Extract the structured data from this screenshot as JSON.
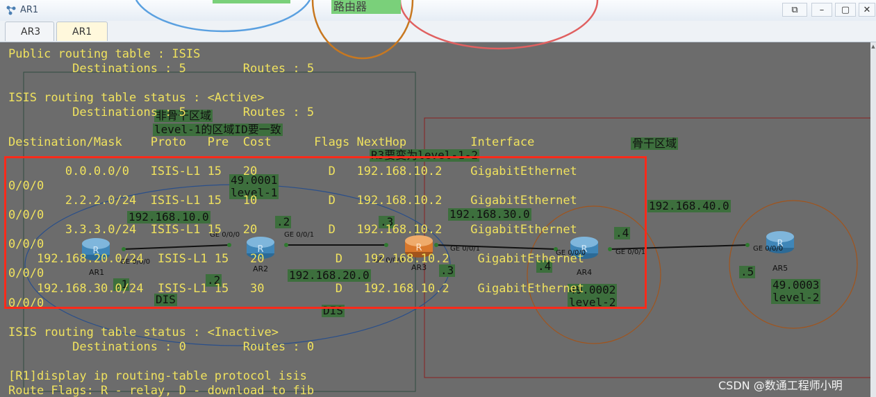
{
  "window": {
    "title": "AR1",
    "controls": [
      "⧉",
      "–",
      "▢",
      "✕"
    ]
  },
  "tabs": [
    {
      "label": "AR3",
      "active": false
    },
    {
      "label": "AR1",
      "active": true
    }
  ],
  "console_text": "Public routing table : ISIS\n         Destinations : 5        Routes : 5\n\nISIS routing table status : <Active>\n         Destinations : 5        Routes : 5\n\nDestination/Mask    Proto   Pre  Cost      Flags NextHop         Interface\n\n        0.0.0.0/0   ISIS-L1 15   20          D   192.168.10.2    GigabitEthernet\n0/0/0\n        2.2.2.0/24  ISIS-L1 15   10          D   192.168.10.2    GigabitEthernet\n0/0/0\n        3.3.3.0/24  ISIS-L1 15   20          D   192.168.10.2    GigabitEthernet\n0/0/0\n    192.168.20.0/24  ISIS-L1 15   20          D   192.168.10.2    GigabitEthernet\n0/0/0\n    192.168.30.0/24  ISIS-L1 15   30          D   192.168.10.2    GigabitEthernet\n0/0/0\n\nISIS routing table status : <Inactive>\n         Destinations : 0        Routes : 0\n\n[R1]display ip routing-table protocol isis\nRoute Flags: R - relay, D - download to fib",
  "topology": {
    "routers": [
      "AR1",
      "AR2",
      "AR3",
      "AR4",
      "AR5"
    ],
    "interfaces": {
      "ar1_ge": "GE 0/0/0",
      "ar2_left": "GE 0/0/0",
      "ar2_right": "GE 0/0/1",
      "ar3_left": "GE 0/0/0",
      "ar3_right": "GE 0/0/1",
      "ar4_left": "GE 0/0/0",
      "ar4_right": "GE 0/0/1",
      "ar5_ge": "GE 0/0/0"
    },
    "notes": {
      "non_backbone": "非骨干区域",
      "level1_rule": "level-1的区域ID要一致",
      "backbone": "骨干区域",
      "ar3_change": "R3要变为level-1-2",
      "area_ar2": "49.0001\nlevel-1",
      "area_ar4": "49.0002\nlevel-2",
      "area_ar5": "49.0003\nlevel-2",
      "net_10": "192.168.10.0",
      "net_20": "192.168.20.0",
      "net_30": "192.168.30.0",
      "net_40": "192.168.40.0",
      "dot_1": ".1",
      "dot_2a": ".2",
      "dot_2b": ".2",
      "dot_3a": ".3",
      "dot_3b": ".3",
      "dot_4a": ".4",
      "dot_4b": ".4",
      "dot_5": ".5",
      "dis_left": "DIS",
      "dis_right": "DIS",
      "top_label": "路由器"
    }
  },
  "watermark": "CSDN @数通工程师小明",
  "colors": {
    "console_bg": "#6c6c6c",
    "console_text": "#f0e25e",
    "note_bg": "#3d6f3d",
    "highlight_box": "#ff2a1a",
    "router_blue": "#3f86b8",
    "router_orange": "#d9782c"
  },
  "icons": {
    "app": "topology-icon",
    "router": "router-icon"
  }
}
